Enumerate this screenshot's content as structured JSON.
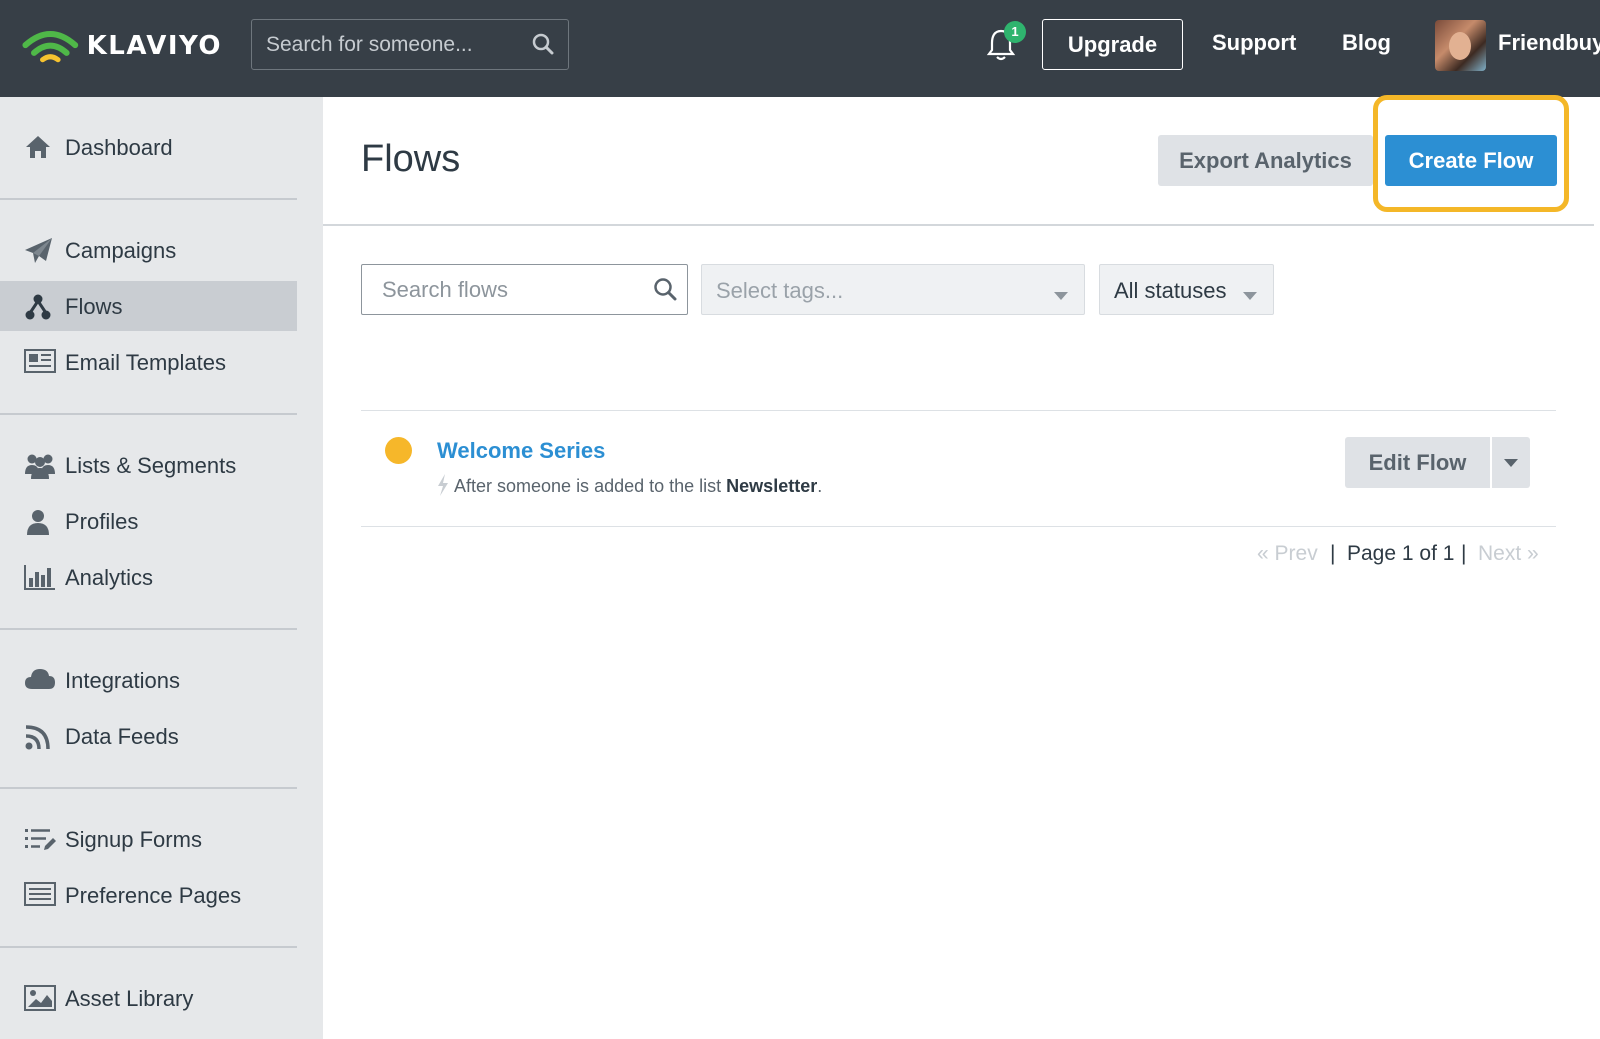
{
  "topbar": {
    "brand": "KLAVIYO",
    "search_placeholder": "Search for someone...",
    "notification_count": "1",
    "upgrade_label": "Upgrade",
    "support_label": "Support",
    "blog_label": "Blog",
    "account_name": "Friendbuy",
    "brand_colors": {
      "bar": "#373f47",
      "logo_green": "#4fb848",
      "logo_yellow": "#f6c32f"
    }
  },
  "sidebar": {
    "items": [
      {
        "label": "Dashboard",
        "icon": "home-icon"
      },
      {
        "label": "Campaigns",
        "icon": "paper-plane-icon"
      },
      {
        "label": "Flows",
        "icon": "flows-icon",
        "active": true
      },
      {
        "label": "Email Templates",
        "icon": "newspaper-icon"
      },
      {
        "label": "Lists & Segments",
        "icon": "users-icon"
      },
      {
        "label": "Profiles",
        "icon": "user-icon"
      },
      {
        "label": "Analytics",
        "icon": "bar-chart-icon"
      },
      {
        "label": "Integrations",
        "icon": "cloud-icon"
      },
      {
        "label": "Data Feeds",
        "icon": "rss-icon"
      },
      {
        "label": "Signup Forms",
        "icon": "list-edit-icon"
      },
      {
        "label": "Preference Pages",
        "icon": "list-box-icon"
      },
      {
        "label": "Asset Library",
        "icon": "image-icon"
      }
    ]
  },
  "main": {
    "title": "Flows",
    "export_label": "Export Analytics",
    "create_label": "Create Flow",
    "highlight_color": "#f4b728",
    "filters": {
      "search_placeholder": "Search flows",
      "tags_placeholder": "Select tags...",
      "status_value": "All statuses"
    },
    "flows": [
      {
        "name": "Welcome Series",
        "status_color": "#f6b72a",
        "trigger_prefix": "After someone is added to the list",
        "trigger_list": "Newsletter",
        "trigger_suffix": ".",
        "edit_label": "Edit Flow"
      }
    ],
    "pagination": {
      "prev": "« Prev",
      "separator": "|",
      "info": "Page 1 of 1",
      "next": "Next »"
    }
  }
}
